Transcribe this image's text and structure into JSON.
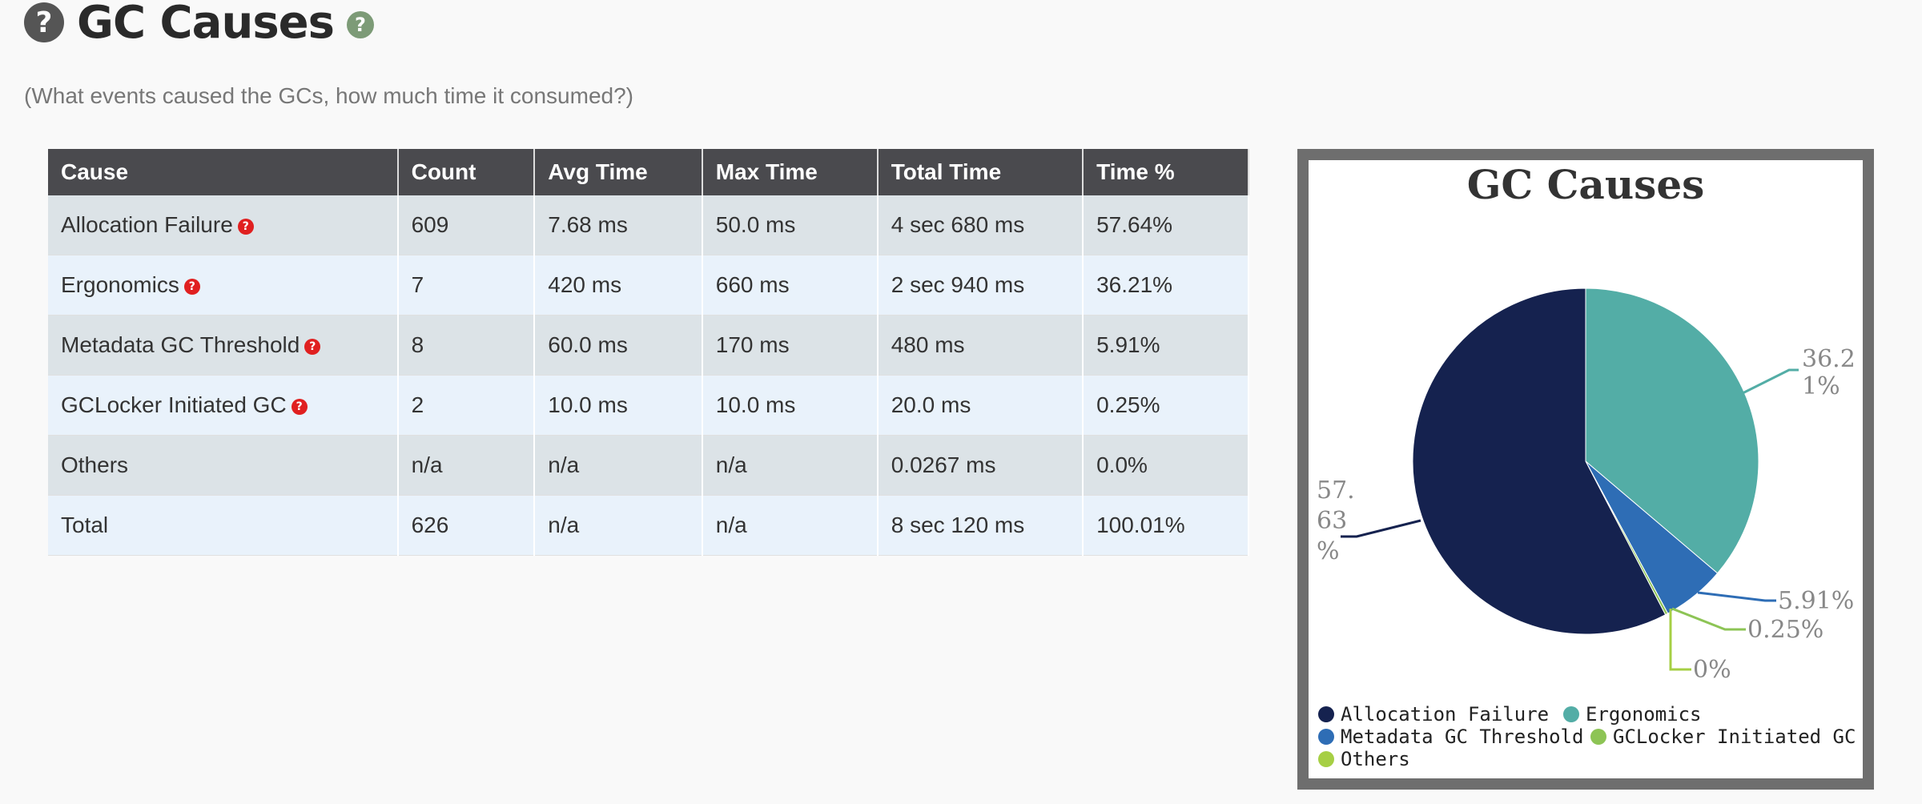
{
  "header": {
    "help_glyph": "?",
    "title": "GC Causes",
    "info_glyph": "?",
    "subtitle": "(What events caused the GCs, how much time it consumed?)"
  },
  "table": {
    "columns": [
      "Cause",
      "Count",
      "Avg Time",
      "Max Time",
      "Total Time",
      "Time %"
    ],
    "rows": [
      {
        "cause": "Allocation Failure",
        "help": true,
        "count": "609",
        "avg": "7.68 ms",
        "max": "50.0 ms",
        "total": "4 sec 680 ms",
        "pct": "57.64%"
      },
      {
        "cause": "Ergonomics",
        "help": true,
        "count": "7",
        "avg": "420 ms",
        "max": "660 ms",
        "total": "2 sec 940 ms",
        "pct": "36.21%"
      },
      {
        "cause": "Metadata GC Threshold",
        "help": true,
        "count": "8",
        "avg": "60.0 ms",
        "max": "170 ms",
        "total": "480 ms",
        "pct": "5.91%"
      },
      {
        "cause": "GCLocker Initiated GC",
        "help": true,
        "count": "2",
        "avg": "10.0 ms",
        "max": "10.0 ms",
        "total": "20.0 ms",
        "pct": "0.25%"
      },
      {
        "cause": "Others",
        "help": false,
        "count": "n/a",
        "avg": "n/a",
        "max": "n/a",
        "total": "0.0267 ms",
        "pct": "0.0%"
      },
      {
        "cause": "Total",
        "help": false,
        "count": "626",
        "avg": "n/a",
        "max": "n/a",
        "total": "8 sec 120 ms",
        "pct": "100.01%"
      }
    ]
  },
  "chart_data": {
    "type": "pie",
    "title": "GC Causes",
    "series": [
      {
        "name": "Allocation Failure",
        "value": 57.63,
        "label": "57.63%",
        "color": "#15224f"
      },
      {
        "name": "Ergonomics",
        "value": 36.21,
        "label": "36.21%",
        "color": "#53ada6"
      },
      {
        "name": "Metadata GC Threshold",
        "value": 5.91,
        "label": "5.91%",
        "color": "#2e6db5"
      },
      {
        "name": "GCLocker Initiated GC",
        "value": 0.25,
        "label": "0.25%",
        "color": "#8dc455"
      },
      {
        "name": "Others",
        "value": 0,
        "label": "0%",
        "color": "#a6cf44"
      }
    ],
    "legend_position": "bottom"
  }
}
